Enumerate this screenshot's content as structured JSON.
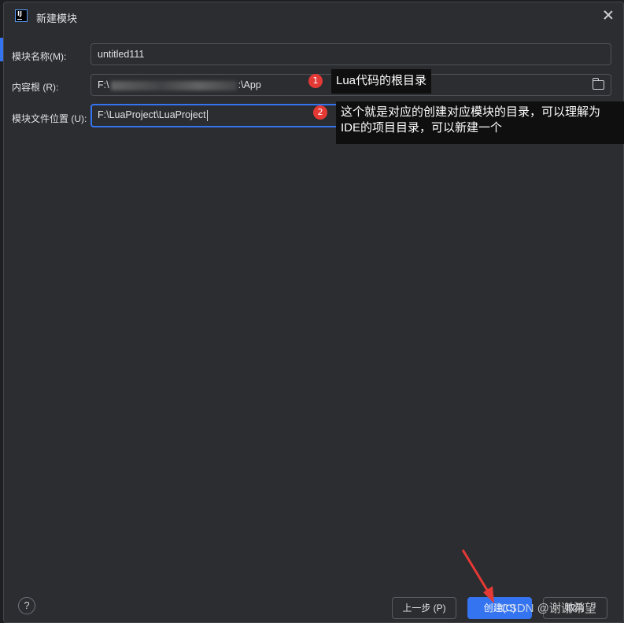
{
  "dialog": {
    "title": "新建模块",
    "logo_text": "IJ"
  },
  "form": {
    "module_name": {
      "label": "模块名称(M):",
      "value": "untitled111"
    },
    "content_root": {
      "label": "内容根 (R):",
      "value_start": "F:\\",
      "value_end": ":\\App"
    },
    "module_file_location": {
      "label": "模块文件位置 (U):",
      "value": "F:\\LuaProject\\LuaProject"
    }
  },
  "annotations": [
    {
      "number": "1",
      "text": "Lua代码的根目录"
    },
    {
      "number": "2",
      "text": "这个就是对应的创建对应模块的目录，可以理解为IDE的项目目录，可以新建一个"
    }
  ],
  "footer": {
    "help": "?",
    "prev_label": "上一步 (P)",
    "create_label": "创建(C)",
    "cancel_label": "取消"
  },
  "watermark": "CSDN @谢谢希望",
  "colors": {
    "accent": "#3574f0",
    "badge": "#e53935",
    "arrow": "#e53935",
    "background": "#2b2d30"
  }
}
